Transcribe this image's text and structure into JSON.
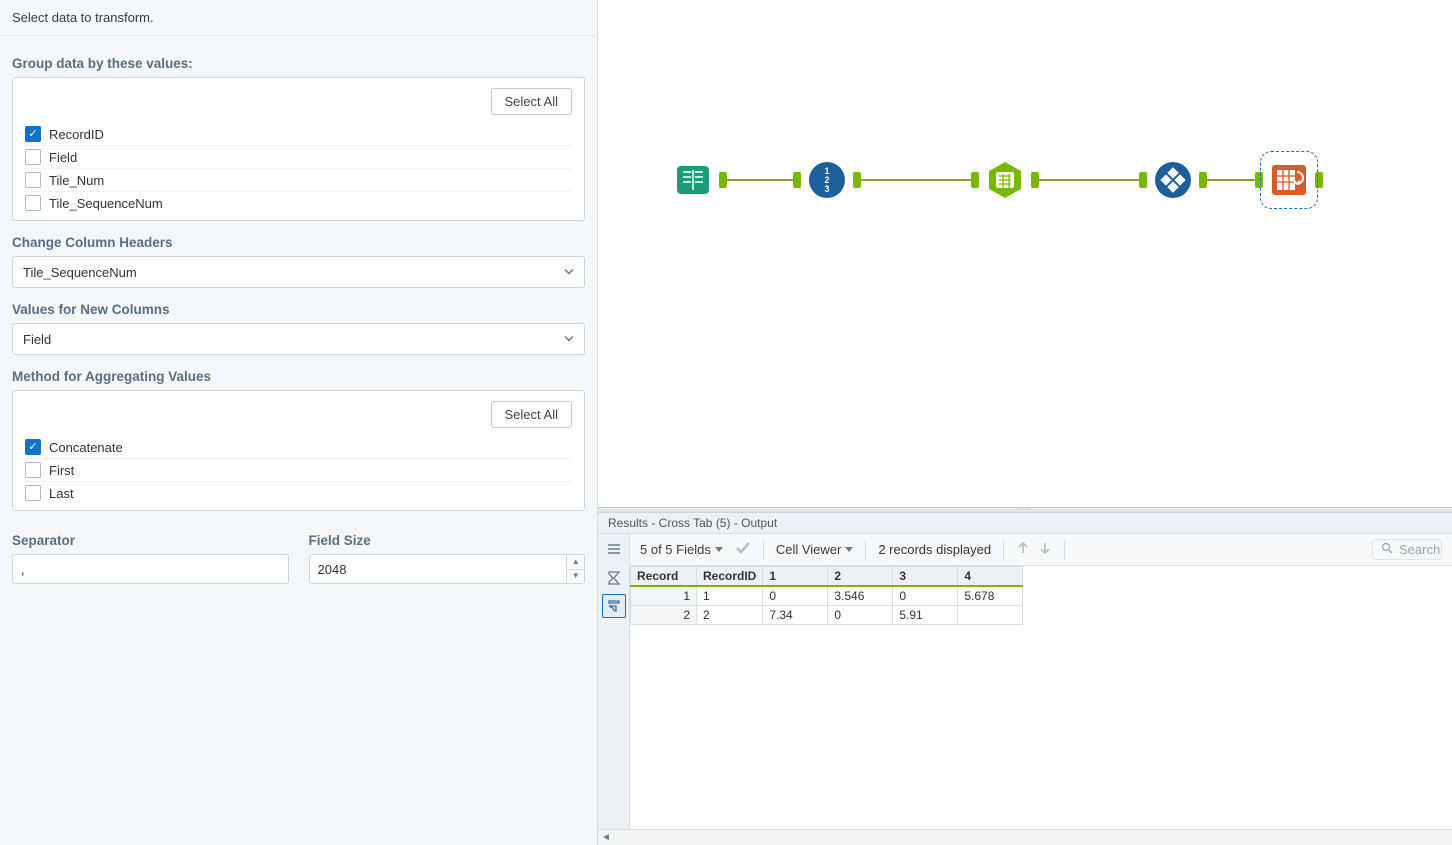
{
  "config": {
    "header": "Select data to transform.",
    "groupBy": {
      "label": "Group data by these values:",
      "selectAll": "Select All",
      "items": [
        {
          "label": "RecordID",
          "checked": true
        },
        {
          "label": "Field",
          "checked": false
        },
        {
          "label": "Tile_Num",
          "checked": false
        },
        {
          "label": "Tile_SequenceNum",
          "checked": false
        }
      ]
    },
    "changeHeaders": {
      "label": "Change Column Headers",
      "value": "Tile_SequenceNum"
    },
    "valuesNew": {
      "label": "Values for New Columns",
      "value": "Field"
    },
    "aggMethod": {
      "label": "Method for Aggregating Values",
      "selectAll": "Select All",
      "items": [
        {
          "label": "Concatenate",
          "checked": true
        },
        {
          "label": "First",
          "checked": false
        },
        {
          "label": "Last",
          "checked": false
        }
      ]
    },
    "separator": {
      "label": "Separator",
      "value": ","
    },
    "fieldSize": {
      "label": "Field Size",
      "value": "2048"
    }
  },
  "workflow": {
    "tools": [
      {
        "name": "text-input",
        "color": "#1b9e77",
        "shape": "book"
      },
      {
        "name": "record-id",
        "color": "#1c5f9c",
        "shape": "numbers"
      },
      {
        "name": "tile",
        "color": "#7ab800",
        "shape": "hex"
      },
      {
        "name": "transpose",
        "color": "#1c5f9c",
        "shape": "diamond"
      },
      {
        "name": "cross-tab",
        "color": "#d55d2c",
        "shape": "crosstab",
        "selected": true
      }
    ]
  },
  "results": {
    "title": "Results - Cross Tab (5) - Output",
    "fieldsInfo": "5 of 5 Fields",
    "cellViewer": "Cell Viewer",
    "recordsInfo": "2 records displayed",
    "searchPlaceholder": "Search",
    "columns": [
      "Record",
      "RecordID",
      "1",
      "2",
      "3",
      "4"
    ],
    "rows": [
      {
        "num": "1",
        "cells": [
          "1",
          "0",
          "3.546",
          "0",
          "5.678"
        ]
      },
      {
        "num": "2",
        "cells": [
          "2",
          "7.34",
          "0",
          "5.91",
          ""
        ]
      }
    ]
  }
}
